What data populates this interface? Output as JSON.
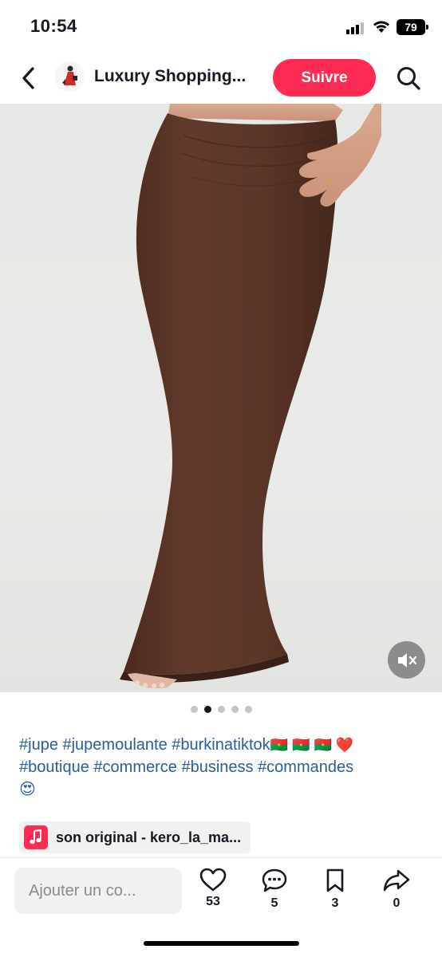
{
  "status_bar": {
    "time": "10:54",
    "battery": "79"
  },
  "header": {
    "account_name": "Luxury Shopping...",
    "follow_label": "Suivre",
    "icons": [
      "back-arrow-icon",
      "avatar",
      "search-icon"
    ]
  },
  "media": {
    "description_icon": "mute-icon",
    "carousel": {
      "total": 5,
      "active": 2
    }
  },
  "caption": {
    "line1": "#jupe #jupemoulante #burkinatiktok",
    "line1_emoji": "🇧🇫 🇧🇫 🇧🇫 ❤️",
    "line2": "#boutique #commerce #business #commandes",
    "line3_emoji": "😍"
  },
  "music": {
    "label": "son original - kero_la_ma..."
  },
  "bottom_bar": {
    "comment_placeholder": "Ajouter un co...",
    "likes": "53",
    "comments": "5",
    "saves": "3",
    "shares": "0"
  },
  "colors": {
    "accent": "#fe2c55",
    "hashtag": "#2b5d9b",
    "skirt": "#5a3426",
    "background": "#e6e8e5"
  }
}
